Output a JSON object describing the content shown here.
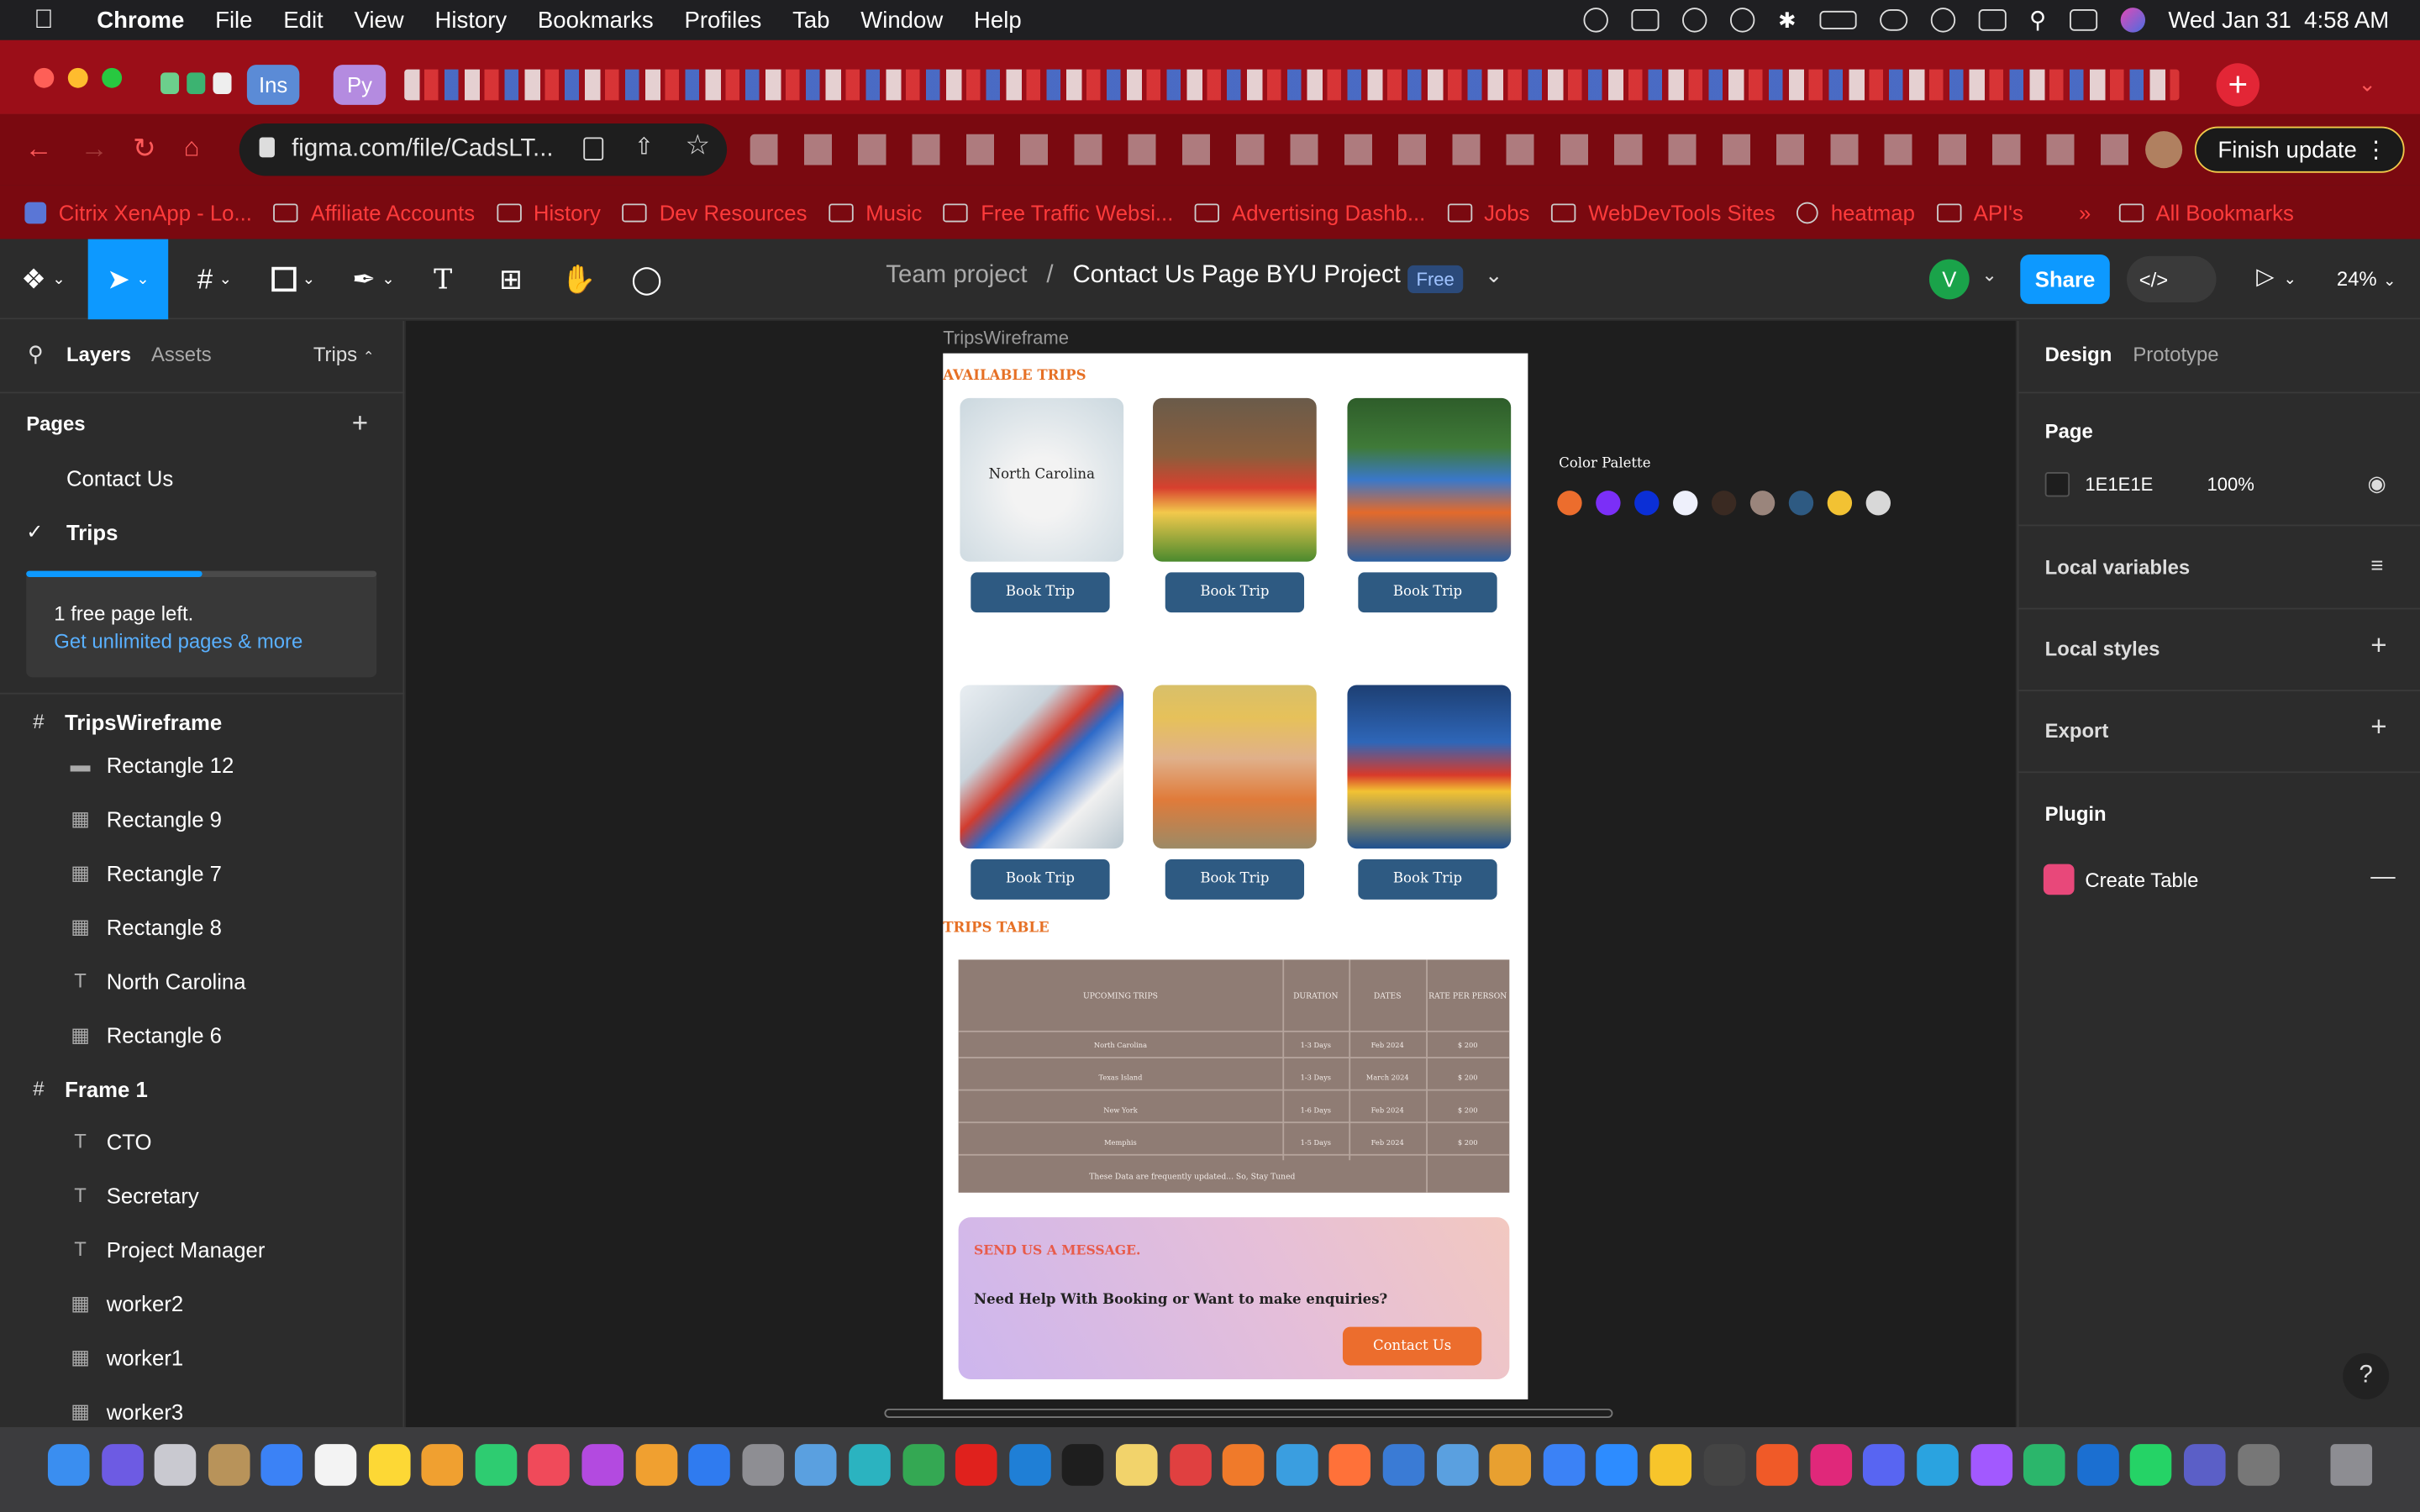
{
  "menubar": {
    "app": "Chrome",
    "items": [
      "File",
      "Edit",
      "View",
      "History",
      "Bookmarks",
      "Profiles",
      "Tab",
      "Window",
      "Help"
    ],
    "datetime": "Wed Jan 31  4:58 AM"
  },
  "browser": {
    "pinned_tabs": [
      "Ins",
      "Py"
    ],
    "url": "figma.com/file/CadsLT...",
    "finish_update": "Finish update",
    "bookmarks": [
      "Citrix XenApp - Lo...",
      "Affiliate Accounts",
      "History",
      "Dev Resources",
      "Music",
      "Free Traffic Websi...",
      "Advertising Dashb...",
      "Jobs",
      "WebDevTools Sites",
      "heatmap",
      "API's"
    ],
    "all_bookmarks": "All Bookmarks"
  },
  "figma": {
    "breadcrumb_team": "Team project",
    "breadcrumb_sep": "/",
    "file_name": "Contact Us Page BYU Project",
    "badge": "Free",
    "avatar_letter": "V",
    "share": "Share",
    "zoom": "24%"
  },
  "left_panel": {
    "tabs": [
      "Layers",
      "Assets"
    ],
    "page_dropdown": "Trips",
    "pages_header": "Pages",
    "pages": [
      "Contact Us",
      "Trips"
    ],
    "upgrade_line1": "1 free page left.",
    "upgrade_line2": "Get unlimited pages & more",
    "upgrade_progress": 0.5,
    "frame1": "TripsWireframe",
    "layers": [
      {
        "name": "Rectangle 12",
        "icon": "rect-icon"
      },
      {
        "name": "Rectangle 9",
        "icon": "image-icon"
      },
      {
        "name": "Rectangle 7",
        "icon": "image-icon"
      },
      {
        "name": "Rectangle 8",
        "icon": "image-icon"
      },
      {
        "name": "North Carolina",
        "icon": "text-icon"
      },
      {
        "name": "Rectangle 6",
        "icon": "image-icon"
      }
    ],
    "frame2": "Frame 1",
    "layers2": [
      {
        "name": "CTO",
        "icon": "text-icon"
      },
      {
        "name": "Secretary",
        "icon": "text-icon"
      },
      {
        "name": "Project Manager",
        "icon": "text-icon"
      },
      {
        "name": "worker2",
        "icon": "image-icon"
      },
      {
        "name": "worker1",
        "icon": "image-icon"
      },
      {
        "name": "worker3",
        "icon": "image-icon"
      }
    ]
  },
  "canvas": {
    "frame_label": "TripsWireframe",
    "available_trips": "AVAILABLE TRIPS",
    "first_card_text": "North Carolina",
    "book_trip": "Book Trip",
    "trips_table": "TRIPS TABLE",
    "table_headers": [
      "UPCOMING TRIPS",
      "DURATION",
      "DATES",
      "RATE PER PERSON"
    ],
    "table_rows": [
      [
        "North Carolina",
        "1-3 Days",
        "Feb 2024",
        "$ 200"
      ],
      [
        "Texas Island",
        "1-3 Days",
        "March 2024",
        "$ 200"
      ],
      [
        "New York",
        "1-6 Days",
        "Feb 2024",
        "$ 200"
      ],
      [
        "Memphis",
        "1-5 Days",
        "Feb 2024",
        "$ 200"
      ]
    ],
    "table_footer": "These Data are frequently updated... So, Stay Tuned",
    "send_message": "SEND US A MESSAGE.",
    "help_text": "Need Help With Booking or Want to make enquiries?",
    "contact_button": "Contact Us",
    "palette_label": "Color Palette",
    "palette": [
      "#ec6d2d",
      "#7b2ff7",
      "#0b2fd6",
      "#eef0fb",
      "#3a2a22",
      "#9a857c",
      "#2e5a82",
      "#f2c233",
      "#d8d8d8"
    ]
  },
  "right_panel": {
    "tabs": [
      "Design",
      "Prototype"
    ],
    "page_label": "Page",
    "bg_hex": "1E1E1E",
    "bg_opacity": "100%",
    "local_variables": "Local variables",
    "local_styles": "Local styles",
    "export": "Export",
    "plugin": "Plugin",
    "plugin_item": "Create Table",
    "help": "?"
  },
  "colors": {
    "accent": "#0d99ff",
    "chrome_red": "#9b0e18",
    "orange": "#e67025",
    "button_blue": "#2e5a82"
  }
}
